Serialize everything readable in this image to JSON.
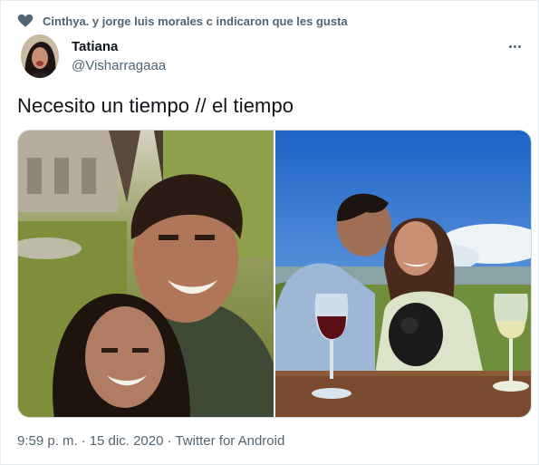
{
  "social_context": {
    "icon": "heart-icon",
    "text": "Cinthya. y jorge luis morales c indicaron que les gusta"
  },
  "author": {
    "name": "Tatiana",
    "handle": "@Visharragaaa"
  },
  "tweet": {
    "text": "Necesito un tiempo // el tiempo"
  },
  "meta": {
    "time": "9:59 p. m.",
    "separator1": "·",
    "date": "15 dic. 2020",
    "separator2": "·",
    "source": "Twitter for Android"
  },
  "colors": {
    "text_primary": "#0f1419",
    "text_secondary": "#536471",
    "border": "#cfd9de"
  }
}
